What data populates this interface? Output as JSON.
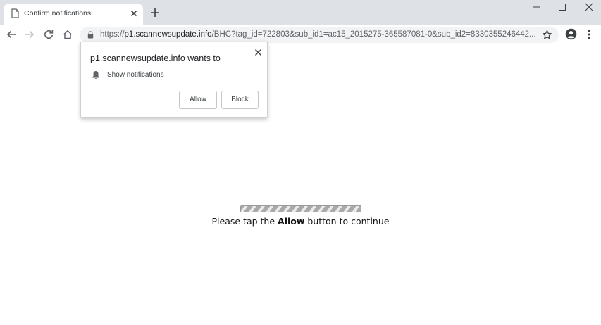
{
  "tab": {
    "title": "Confirm notifications",
    "favicon": "page-icon",
    "close_icon": "close-icon"
  },
  "tabstrip": {
    "new_tab_icon": "plus-icon",
    "window_controls": [
      "minimize-icon",
      "maximize-icon",
      "close-icon"
    ]
  },
  "toolbar": {
    "nav_icons": [
      "back-arrow-icon",
      "forward-arrow-icon",
      "reload-icon",
      "home-icon"
    ],
    "url_scheme": "https://",
    "url_host": "p1.scannewsupdate.info",
    "url_path": "/BHC?tag_id=722803&sub_id1=ac15_2015275-365587081-0&sub_id2=8330355246442...",
    "right_icons": [
      "star-icon",
      "account-icon",
      "menu-icon"
    ]
  },
  "popup": {
    "title": "p1.scannewsupdate.info wants to",
    "permission_label": "Show notifications",
    "allow_label": "Allow",
    "block_label": "Block"
  },
  "page": {
    "message_before": "Please tap the ",
    "message_bold": "Allow",
    "message_after": " button to continue",
    "progress_style": "striped-indeterminate"
  },
  "colors": {
    "tabstrip_bg": "#dee1e6",
    "omnibox_bg": "#f1f3f4",
    "icon_color": "#5f6368",
    "text_color": "#202124"
  }
}
